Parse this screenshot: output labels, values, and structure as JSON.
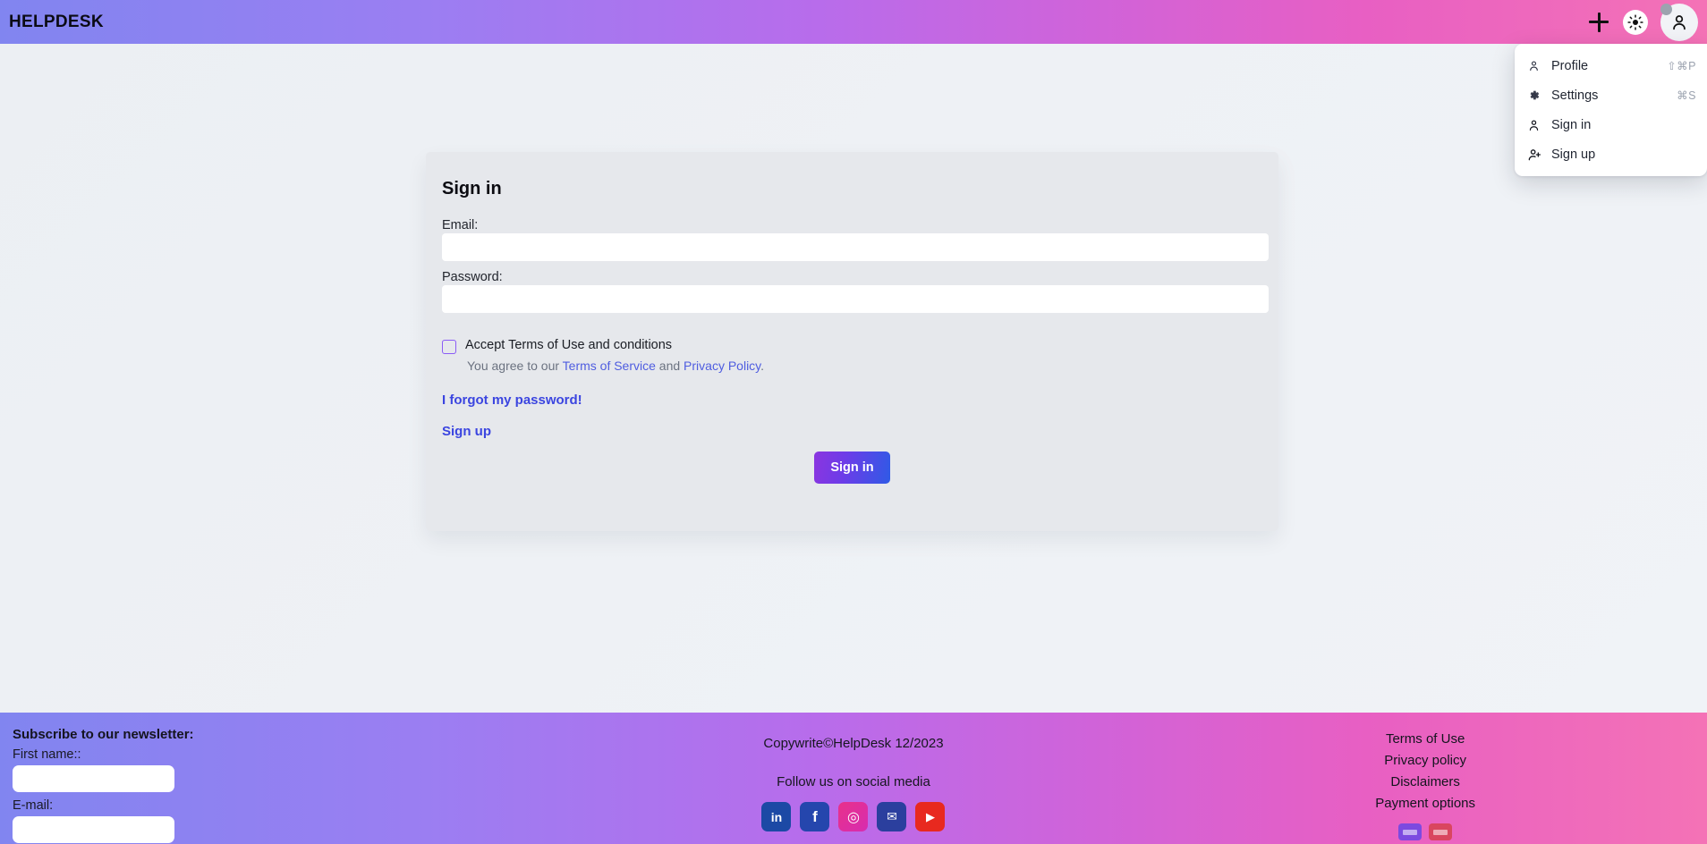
{
  "header": {
    "brand": "HELPDESK",
    "icons": [
      {
        "name": "plus-icon",
        "label": "+"
      },
      {
        "name": "theme-toggle-icon",
        "label": "brightness"
      },
      {
        "name": "avatar",
        "label": "account"
      }
    ]
  },
  "menu": {
    "items": [
      {
        "icon": "user-icon",
        "label": "Profile",
        "shortcut": "⇧⌘P"
      },
      {
        "icon": "gear-icon",
        "label": "Settings",
        "shortcut": "⌘S"
      },
      {
        "icon": "user-icon",
        "label": "Sign in",
        "shortcut": ""
      },
      {
        "icon": "user-plus-icon",
        "label": "Sign up",
        "shortcut": ""
      }
    ]
  },
  "signin_card": {
    "title": "Sign in",
    "email_label": "Email:",
    "email_value": "",
    "email_placeholder": "",
    "password_label": "Password:",
    "password_value": "",
    "password_placeholder": "",
    "checkbox_label": "Accept Terms of Use and conditions",
    "terms_prefix": "You agree to our ",
    "terms_link": "Terms of Service",
    "terms_middle": " and ",
    "privacy_link": "Privacy Policy",
    "terms_suffix": ".",
    "forgot_label": "I forgot my password!",
    "signup_label": "Sign up",
    "submit_label": "Sign in"
  },
  "footer": {
    "newsletter_title": "Subscribe to our newsletter:",
    "first_name_label": "First name::",
    "first_name_value": "",
    "email_label": "E-mail:",
    "email_value": "",
    "copyright": "Copywrite©HelpDesk 12/2023",
    "follow_text": "Follow us on social media",
    "socials": [
      {
        "name": "linkedin-icon",
        "glyph": "in",
        "color": "#1c49a5"
      },
      {
        "name": "facebook-icon",
        "glyph": "f",
        "color": "#2546ad"
      },
      {
        "name": "instagram-icon",
        "glyph": "◎",
        "color": "#d72cb0"
      },
      {
        "name": "twitter-icon",
        "glyph": "✉",
        "color": "#2b3f9e"
      },
      {
        "name": "youtube-icon",
        "glyph": "▶",
        "color": "#e8291f"
      }
    ],
    "links": [
      "Terms of Use",
      "Privacy policy",
      "Disclaimers",
      "Payment options"
    ],
    "payment_cards": [
      {
        "name": "payment-card-visa",
        "color": "#7c4ae0"
      },
      {
        "name": "payment-card-mastercard",
        "color": "#d9465f"
      }
    ]
  },
  "colors": {
    "gradient_start": "#8185f0",
    "gradient_end": "#f472b6",
    "link": "#4f5de0",
    "strong_link": "#3b45e0",
    "checkbox_border": "#8b5cf6",
    "card_bg": "#e6e8ec",
    "page_bg": "#eef1f5",
    "button_gradient_start": "#8b35e0",
    "button_gradient_end": "#2f5ae6"
  }
}
